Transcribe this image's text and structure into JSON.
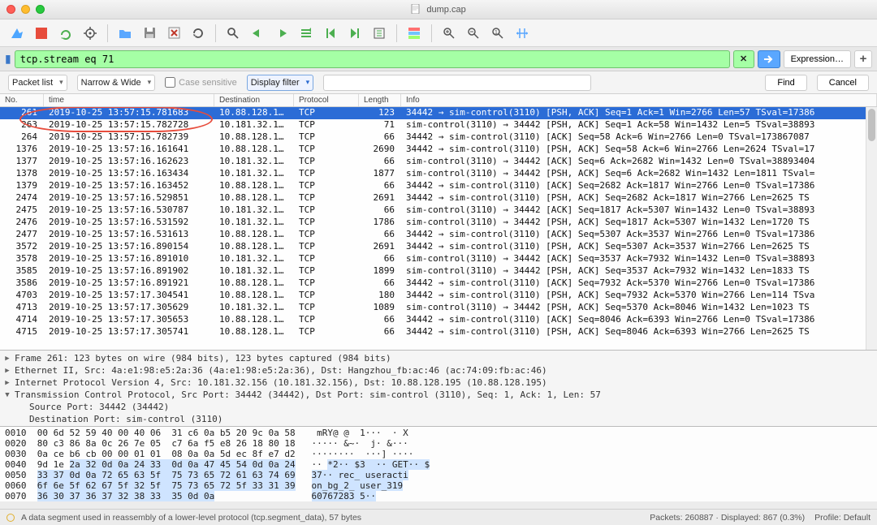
{
  "window": {
    "filename": "dump.cap"
  },
  "filter": {
    "value": "tcp.stream eq 71",
    "expression_label": "Expression…"
  },
  "search": {
    "packet_list": "Packet list",
    "narrow_wide": "Narrow & Wide",
    "case_label": "Case sensitive",
    "display_filter": "Display filter",
    "find": "Find",
    "cancel": "Cancel"
  },
  "columns": {
    "no": "No.",
    "time": "time",
    "dest": "Destination",
    "proto": "Protocol",
    "len": "Length",
    "info": "Info"
  },
  "packets": [
    {
      "no": "261",
      "time": "2019-10-25 13:57:15.781683",
      "dest": "10.88.128.1…",
      "proto": "TCP",
      "len": "123",
      "info": "34442 → sim-control(3110) [PSH, ACK] Seq=1 Ack=1 Win=2766 Len=57 TSval=17386",
      "sel": true
    },
    {
      "no": "263",
      "time": "2019-10-25 13:57:15.782728",
      "dest": "10.181.32.1…",
      "proto": "TCP",
      "len": "71",
      "info": "sim-control(3110) → 34442 [PSH, ACK] Seq=1 Ack=58 Win=1432 Len=5 TSval=38893"
    },
    {
      "no": "264",
      "time": "2019-10-25 13:57:15.782739",
      "dest": "10.88.128.1…",
      "proto": "TCP",
      "len": "66",
      "info": "34442 → sim-control(3110) [ACK] Seq=58 Ack=6 Win=2766 Len=0 TSval=173867087"
    },
    {
      "no": "1376",
      "time": "2019-10-25 13:57:16.161641",
      "dest": "10.88.128.1…",
      "proto": "TCP",
      "len": "2690",
      "info": "34442 → sim-control(3110) [PSH, ACK] Seq=58 Ack=6 Win=2766 Len=2624 TSval=17"
    },
    {
      "no": "1377",
      "time": "2019-10-25 13:57:16.162623",
      "dest": "10.181.32.1…",
      "proto": "TCP",
      "len": "66",
      "info": "sim-control(3110) → 34442 [ACK] Seq=6 Ack=2682 Win=1432 Len=0 TSval=38893404"
    },
    {
      "no": "1378",
      "time": "2019-10-25 13:57:16.163434",
      "dest": "10.181.32.1…",
      "proto": "TCP",
      "len": "1877",
      "info": "sim-control(3110) → 34442 [PSH, ACK] Seq=6 Ack=2682 Win=1432 Len=1811 TSval="
    },
    {
      "no": "1379",
      "time": "2019-10-25 13:57:16.163452",
      "dest": "10.88.128.1…",
      "proto": "TCP",
      "len": "66",
      "info": "34442 → sim-control(3110) [ACK] Seq=2682 Ack=1817 Win=2766 Len=0 TSval=17386"
    },
    {
      "no": "2474",
      "time": "2019-10-25 13:57:16.529851",
      "dest": "10.88.128.1…",
      "proto": "TCP",
      "len": "2691",
      "info": "34442 → sim-control(3110) [PSH, ACK] Seq=2682 Ack=1817 Win=2766 Len=2625 TS"
    },
    {
      "no": "2475",
      "time": "2019-10-25 13:57:16.530787",
      "dest": "10.181.32.1…",
      "proto": "TCP",
      "len": "66",
      "info": "sim-control(3110) → 34442 [ACK] Seq=1817 Ack=5307 Win=1432 Len=0 TSval=38893"
    },
    {
      "no": "2476",
      "time": "2019-10-25 13:57:16.531592",
      "dest": "10.181.32.1…",
      "proto": "TCP",
      "len": "1786",
      "info": "sim-control(3110) → 34442 [PSH, ACK] Seq=1817 Ack=5307 Win=1432 Len=1720 TS"
    },
    {
      "no": "2477",
      "time": "2019-10-25 13:57:16.531613",
      "dest": "10.88.128.1…",
      "proto": "TCP",
      "len": "66",
      "info": "34442 → sim-control(3110) [ACK] Seq=5307 Ack=3537 Win=2766 Len=0 TSval=17386"
    },
    {
      "no": "3572",
      "time": "2019-10-25 13:57:16.890154",
      "dest": "10.88.128.1…",
      "proto": "TCP",
      "len": "2691",
      "info": "34442 → sim-control(3110) [PSH, ACK] Seq=5307 Ack=3537 Win=2766 Len=2625 TS"
    },
    {
      "no": "3578",
      "time": "2019-10-25 13:57:16.891010",
      "dest": "10.181.32.1…",
      "proto": "TCP",
      "len": "66",
      "info": "sim-control(3110) → 34442 [ACK] Seq=3537 Ack=7932 Win=1432 Len=0 TSval=38893"
    },
    {
      "no": "3585",
      "time": "2019-10-25 13:57:16.891902",
      "dest": "10.181.32.1…",
      "proto": "TCP",
      "len": "1899",
      "info": "sim-control(3110) → 34442 [PSH, ACK] Seq=3537 Ack=7932 Win=1432 Len=1833 TS"
    },
    {
      "no": "3586",
      "time": "2019-10-25 13:57:16.891921",
      "dest": "10.88.128.1…",
      "proto": "TCP",
      "len": "66",
      "info": "34442 → sim-control(3110) [ACK] Seq=7932 Ack=5370 Win=2766 Len=0 TSval=17386"
    },
    {
      "no": "4703",
      "time": "2019-10-25 13:57:17.304541",
      "dest": "10.88.128.1…",
      "proto": "TCP",
      "len": "180",
      "info": "34442 → sim-control(3110) [PSH, ACK] Seq=7932 Ack=5370 Win=2766 Len=114 TSva"
    },
    {
      "no": "4713",
      "time": "2019-10-25 13:57:17.305629",
      "dest": "10.181.32.1…",
      "proto": "TCP",
      "len": "1089",
      "info": "sim-control(3110) → 34442 [PSH, ACK] Seq=5370 Ack=8046 Win=1432 Len=1023 TS"
    },
    {
      "no": "4714",
      "time": "2019-10-25 13:57:17.305653",
      "dest": "10.88.128.1…",
      "proto": "TCP",
      "len": "66",
      "info": "34442 → sim-control(3110) [ACK] Seq=8046 Ack=6393 Win=2766 Len=0 TSval=17386"
    },
    {
      "no": "4715",
      "time": "2019-10-25 13:57:17.305741",
      "dest": "10.88.128.1…",
      "proto": "TCP",
      "len": "66",
      "info": "34442 → sim-control(3110) [PSH, ACK] Seq=8046 Ack=6393 Win=2766 Len=2625 TS"
    }
  ],
  "details": {
    "frame": "Frame 261: 123 bytes on wire (984 bits), 123 bytes captured (984 bits)",
    "eth": "Ethernet II, Src: 4a:e1:98:e5:2a:36 (4a:e1:98:e5:2a:36), Dst: Hangzhou_fb:ac:46 (ac:74:09:fb:ac:46)",
    "ip": "Internet Protocol Version 4, Src: 10.181.32.156 (10.181.32.156), Dst: 10.88.128.195 (10.88.128.195)",
    "tcp": "Transmission Control Protocol, Src Port: 34442 (34442), Dst Port: sim-control (3110), Seq: 1, Ack: 1, Len: 57",
    "src_port": "Source Port: 34442 (34442)",
    "dst_port": "Destination Port: sim-control (3110)"
  },
  "hex": {
    "l1_off": "0010",
    "l1_hex": "00 6d 52 59 40 00 40 06  31 c6 0a b5 20 9c 0a 58",
    "l1_txt": " mRY@ @  1···  · X",
    "l2_off": "0020",
    "l2_hex": "80 c3 86 8a 0c 26 7e 05  c7 6a f5 e8 26 18 80 18",
    "l2_txt": "····· &~·  j· &···",
    "l3_off": "0030",
    "l3_hex": "0a ce b6 cb 00 00 01 01  08 0a 0a 5d ec 8f e7 d2",
    "l3_txt": "········  ···] ····",
    "l4_off": "0040",
    "l4_hex": "9d 1e ",
    "l4_hl": "2a 32 0d 0a 24 33  0d 0a 47 45 54 0d 0a 24",
    "l4_txt": "·· ",
    "l4_thl": "*2·· $3  ·· GET·· $",
    "l5_off": "0050",
    "l5_hl": "33 37 0d 0a 72 65 63 5f  75 73 65 72 61 63 74 69",
    "l5_thl": "37·· rec_ useracti",
    "l6_off": "0060",
    "l6_hl": "6f 6e 5f 62 67 5f 32 5f  75 73 65 72 5f 33 31 39",
    "l6_thl": "on_bg_2_ user_319",
    "l7_off": "0070",
    "l7_hl": "36 30 37 36 37 32 38 33  35 0d 0a",
    "l7_thl": "60767283 5··"
  },
  "status": {
    "left": "A data segment used in reassembly of a lower-level protocol (tcp.segment_data), 57 bytes",
    "center": "Packets: 260887 · Displayed: 867 (0.3%)",
    "right": "Profile: Default"
  }
}
